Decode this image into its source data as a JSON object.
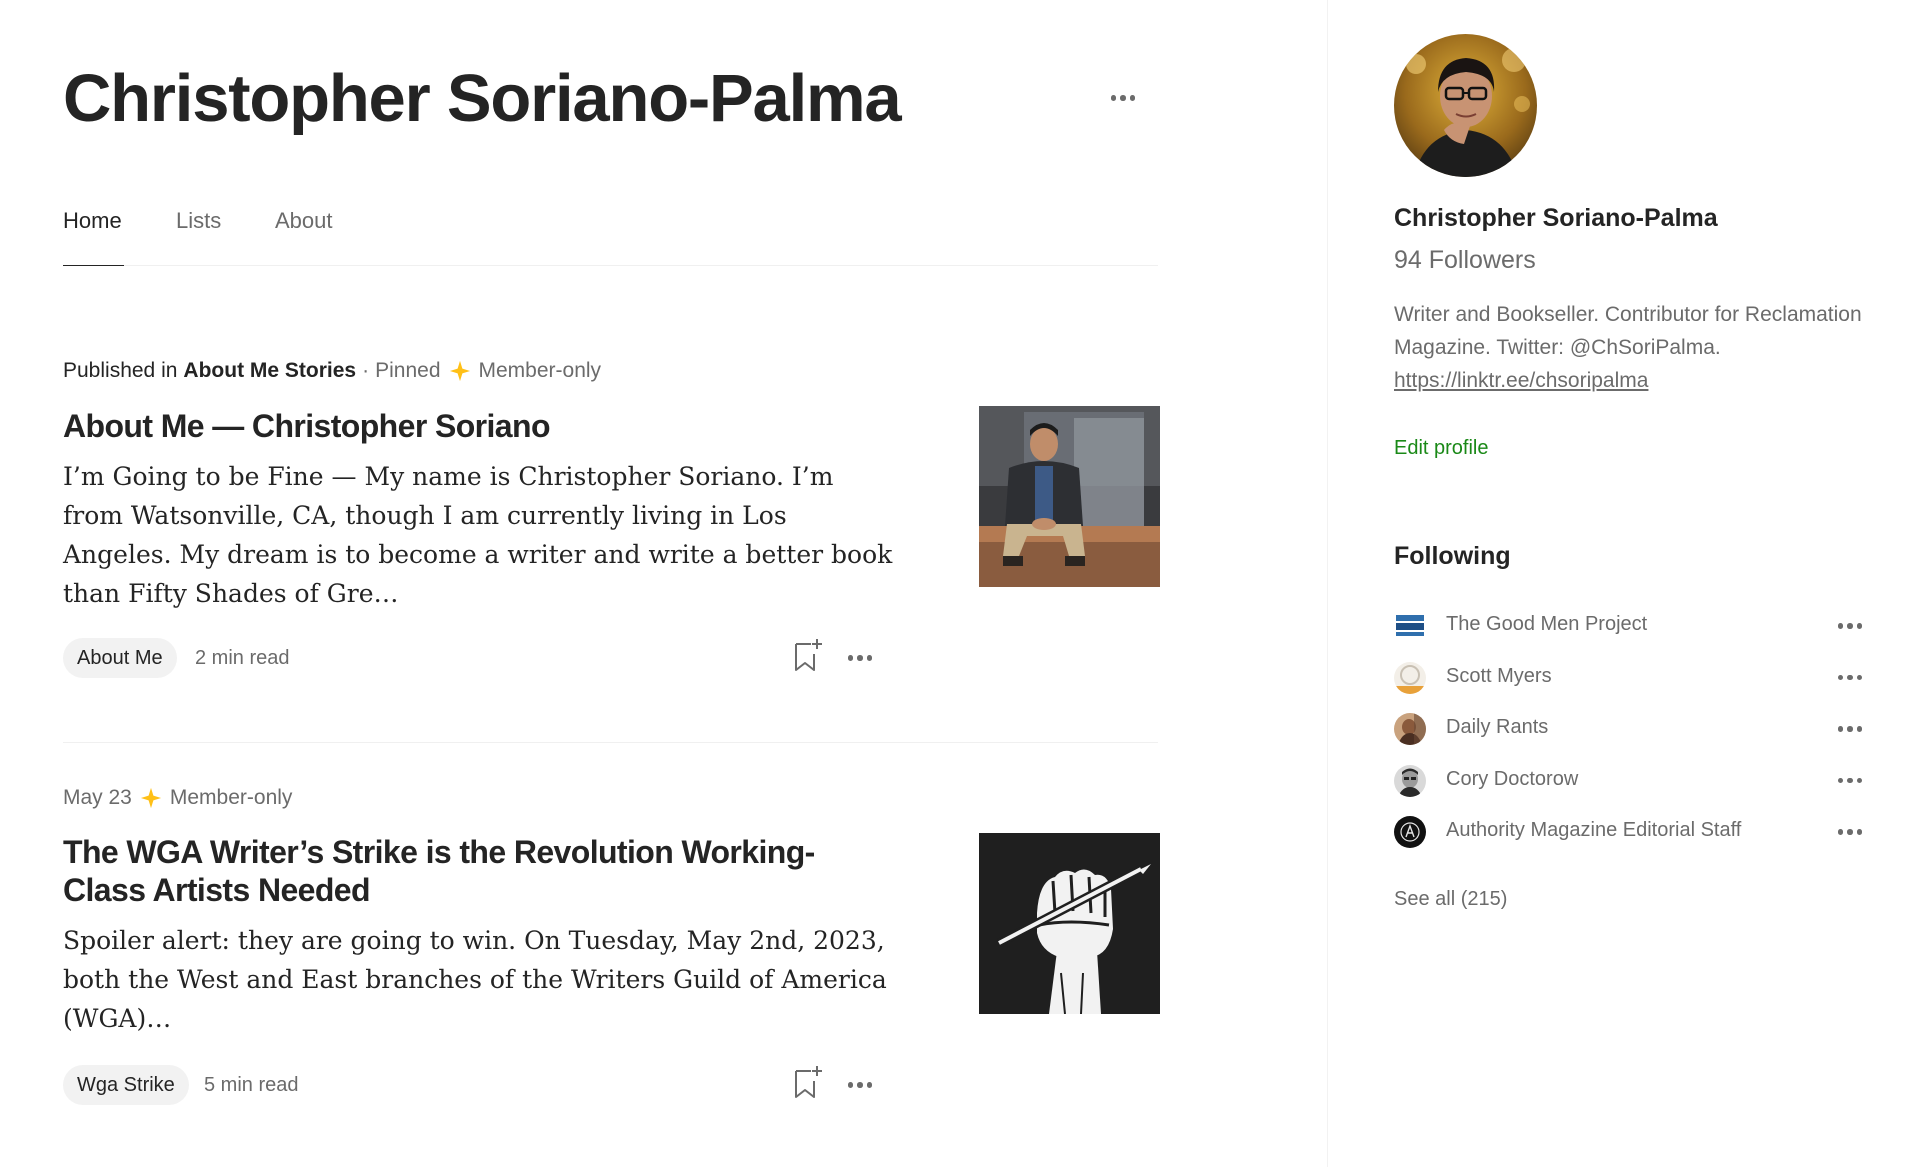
{
  "profile": {
    "name": "Christopher Soriano-Palma"
  },
  "tabs": [
    {
      "label": "Home",
      "active": true
    },
    {
      "label": "Lists",
      "active": false
    },
    {
      "label": "About",
      "active": false
    }
  ],
  "articles": [
    {
      "meta": {
        "published_in_label": "Published in",
        "publication": "About Me Stories",
        "separator": "·",
        "pinned": "Pinned",
        "member_only": "Member-only"
      },
      "title": "About Me — Christopher Soriano",
      "excerpt": "I’m Going to be Fine — My name is Christopher Soriano. I’m from Watsonville, CA, though I am currently living in Los Angeles. My dream is to become a writer and write a better book than Fifty Shades of Gre…",
      "tag": "About Me",
      "read_time": "2 min read"
    },
    {
      "meta": {
        "date": "May 23",
        "member_only": "Member-only"
      },
      "title": "The WGA Writer’s Strike is the Revolution Working-Class Artists Needed",
      "excerpt": "Spoiler alert: they are going to win. On Tuesday, May 2nd, 2023, both the West and East branches of the Writers Guild of America (WGA)…",
      "tag": "Wga Strike",
      "read_time": "5 min read"
    }
  ],
  "sidebar": {
    "name": "Christopher Soriano-Palma",
    "followers": "94 Followers",
    "bio_text": "Writer and Bookseller. Contributor for Reclamation Magazine. Twitter: @ChSoriPalma.",
    "bio_link": "https://linktr.ee/chsoripalma",
    "edit_profile": "Edit profile",
    "following_heading": "Following",
    "following": [
      {
        "name": "The Good Men Project",
        "icon": "good-men-project-logo"
      },
      {
        "name": "Scott Myers",
        "icon": "scott-myers-avatar"
      },
      {
        "name": "Daily Rants",
        "icon": "daily-rants-avatar"
      },
      {
        "name": "Cory Doctorow",
        "icon": "cory-doctorow-avatar"
      },
      {
        "name": "Authority Magazine Editorial Staff",
        "icon": "authority-magazine-logo"
      }
    ],
    "see_all": "See all (215)"
  },
  "colors": {
    "accent_green": "#1a8917",
    "member_star": "#ffc017",
    "text_primary": "#242424",
    "text_secondary": "#6b6b6b"
  }
}
